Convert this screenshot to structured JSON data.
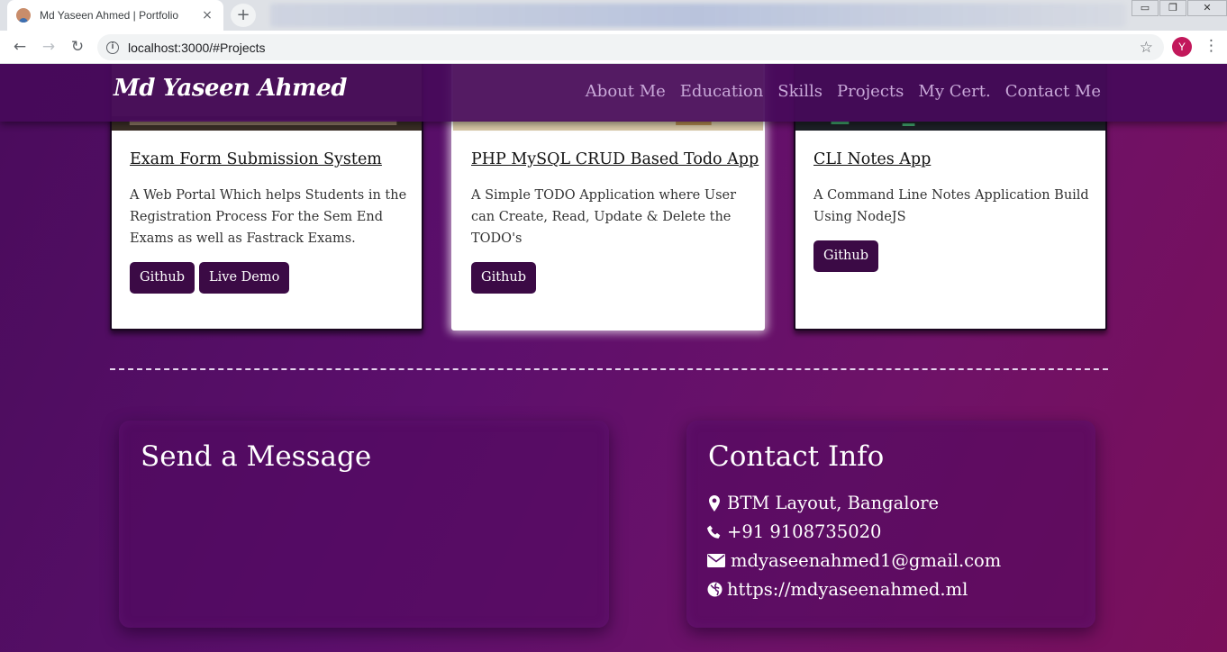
{
  "browser": {
    "tab_title": "Md Yaseen Ahmed | Portfolio",
    "tab_close": "×",
    "new_tab": "+",
    "url": "localhost:3000/#Projects",
    "profile_initial": "Y",
    "window_controls": {
      "minimize": "▭",
      "maximize": "❐",
      "close": "✕"
    }
  },
  "site": {
    "brand": "Md Yaseen Ahmed",
    "nav": [
      "About Me",
      "Education",
      "Skills",
      "Projects",
      "My Cert.",
      "Contact Me"
    ]
  },
  "projects": [
    {
      "title": "Exam Form Submission System",
      "description": "A Web Portal Which helps Students in the Registration Process For the Sem End Exams as well as Fastrack Exams.",
      "buttons": [
        "Github",
        "Live Demo"
      ]
    },
    {
      "title": "PHP MySQL CRUD Based Todo App",
      "description": "A Simple TODO Application where User can Create, Read, Update & Delete the TODO's",
      "buttons": [
        "Github"
      ]
    },
    {
      "title": "CLI Notes App",
      "description": "A Command Line Notes Application Build Using NodeJS",
      "buttons": [
        "Github"
      ]
    }
  ],
  "message_panel": {
    "title": "Send a Message"
  },
  "contact_panel": {
    "title": "Contact Info",
    "items": [
      {
        "icon": "map-marker-icon",
        "text": "BTM Layout, Bangalore"
      },
      {
        "icon": "phone-icon",
        "text": "+91 9108735020"
      },
      {
        "icon": "envelope-icon",
        "text": "mdyaseenahmed1@gmail.com"
      },
      {
        "icon": "globe-icon",
        "text": "https://mdyaseenahmed.ml"
      }
    ]
  },
  "colors": {
    "nav_bg": "#460a5a",
    "button_bg": "#3b0a45",
    "nav_link": "#c9a9d9",
    "page_gradient_start": "#4a0c5c",
    "page_gradient_end": "#7a0f5a"
  }
}
